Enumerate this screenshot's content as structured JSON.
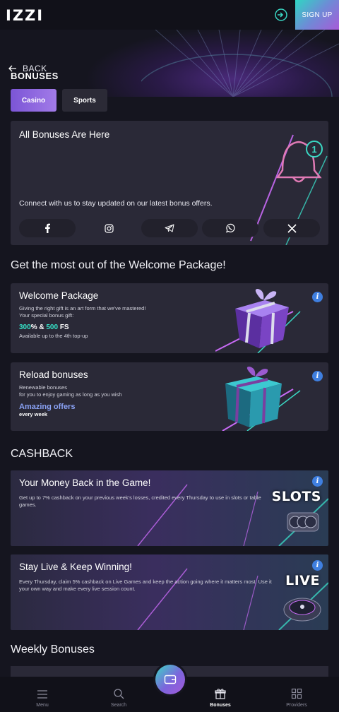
{
  "header": {
    "logo": "IZZI",
    "signup_label": "SIGN UP"
  },
  "nav": {
    "back_label": "BACK"
  },
  "page": {
    "title": "BONUSES"
  },
  "tabs": [
    {
      "label": "Casino",
      "active": true
    },
    {
      "label": "Sports",
      "active": false
    }
  ],
  "notify_card": {
    "title": "All Bonuses Are Here",
    "badge_count": "1",
    "text": "Connect with us to stay updated on our latest bonus offers.",
    "socials": [
      "facebook-icon",
      "instagram-icon",
      "telegram-icon",
      "whatsapp-icon",
      "x-icon"
    ]
  },
  "welcome_section": {
    "title": "Get the most out of the Welcome Package!",
    "cards": [
      {
        "title": "Welcome Package",
        "line1": "Giving the right gift is an art form that we've mastered!",
        "line2": "Your special bonus gift:",
        "highlight_a": "300",
        "highlight_sep": "% & ",
        "highlight_b": "500",
        "highlight_suffix": " FS",
        "footer": "Available up to the 4th top-up"
      },
      {
        "title": "Reload bonuses",
        "line1": "Renewable bonuses",
        "line2": "for you to enjoy gaming as long as you wish",
        "highlight": "Amazing offers",
        "footer": "every week"
      }
    ]
  },
  "cashback_section": {
    "title": "CASHBACK",
    "cards": [
      {
        "title": "Your Money Back in the Game!",
        "text": "Get up to 7% cashback on your previous week's losses, credited every Thursday to use in slots or table games.",
        "word": "SLOTS"
      },
      {
        "title": "Stay Live & Keep Winning!",
        "text": "Every Thursday, claim 5% cashback on Live Games and keep the action going where it matters most. Use it your own way and make every live session count.",
        "word": "LIVE"
      }
    ]
  },
  "weekly_section": {
    "title": "Weekly Bonuses"
  },
  "bottom_nav": [
    {
      "label": "Menu",
      "icon": "menu-icon",
      "active": false
    },
    {
      "label": "Search",
      "icon": "search-icon",
      "active": false
    },
    {
      "label": "Bonuses",
      "icon": "gift-icon",
      "active": true
    },
    {
      "label": "Providers",
      "icon": "grid-icon",
      "active": false
    }
  ],
  "colors": {
    "accent_purple": "#7b55d6",
    "accent_teal": "#35e4c9",
    "info_blue": "#3f7fe0",
    "background": "#15151f",
    "card": "#2a2937"
  }
}
